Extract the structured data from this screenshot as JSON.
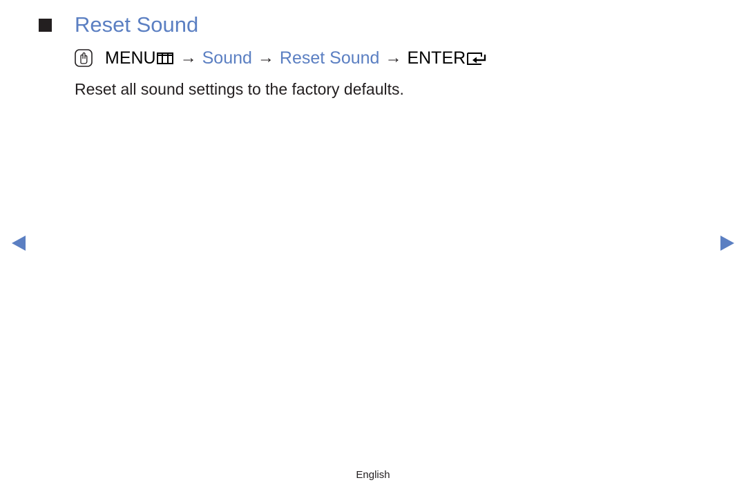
{
  "page": {
    "title": "Reset Sound",
    "breadcrumb": {
      "om_icon": "om-hand-icon",
      "menu_label": "MENU",
      "menu_icon": "menu-icon",
      "separator": "→",
      "items": [
        "Sound",
        "Reset Sound"
      ],
      "enter_label": "ENTER",
      "enter_icon": "enter-icon"
    },
    "description": "Reset all sound settings to the factory defaults."
  },
  "navigation": {
    "prev_icon": "triangle-left-icon",
    "next_icon": "triangle-right-icon"
  },
  "footer": {
    "language": "English"
  },
  "colors": {
    "accent": "#5b7fc2",
    "text": "#231f20",
    "nav": "#5b7fc2"
  }
}
